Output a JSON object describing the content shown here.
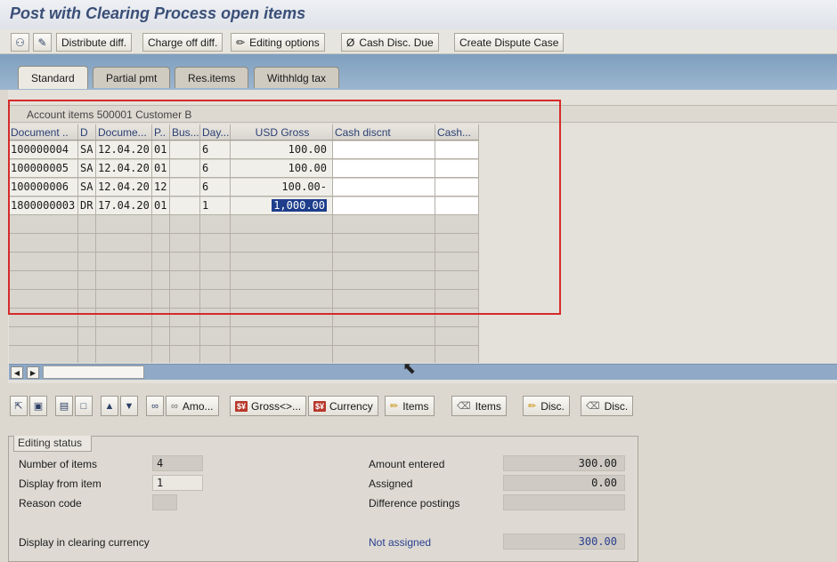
{
  "window": {
    "title": "Post with Clearing Process open items"
  },
  "toolbar": {
    "buttons": [
      {
        "label": "Distribute diff."
      },
      {
        "label": "Charge off diff."
      },
      {
        "label": "Editing options"
      },
      {
        "label": "Cash Disc. Due"
      },
      {
        "label": "Create Dispute Case"
      }
    ]
  },
  "tabs": [
    {
      "label": "Standard",
      "active": true
    },
    {
      "label": "Partial pmt",
      "active": false
    },
    {
      "label": "Res.items",
      "active": false
    },
    {
      "label": "Withhldg tax",
      "active": false
    }
  ],
  "grid": {
    "title": "Account items 500001 Customer B",
    "columns": [
      "Document ..",
      "D",
      "Docume...",
      "P..",
      "Bus...",
      "Day...",
      "USD Gross",
      "Cash discnt",
      "Cash..."
    ],
    "rows": [
      {
        "doc": "100000004",
        "d": "SA",
        "date": "12.04.20",
        "p": "01",
        "bus": "",
        "day": "6",
        "gross": "100.00",
        "cash_discnt": "",
        "cash": ""
      },
      {
        "doc": "100000005",
        "d": "SA",
        "date": "12.04.20",
        "p": "01",
        "bus": "",
        "day": "6",
        "gross": "100.00",
        "cash_discnt": "",
        "cash": ""
      },
      {
        "doc": "100000006",
        "d": "SA",
        "date": "12.04.20",
        "p": "12",
        "bus": "",
        "day": "6",
        "gross": "100.00-",
        "cash_discnt": "",
        "cash": ""
      },
      {
        "doc": "1800000003",
        "d": "DR",
        "date": "17.04.20",
        "p": "01",
        "bus": "",
        "day": "1",
        "gross": "1,000.00",
        "cash_discnt": "",
        "cash": ""
      }
    ]
  },
  "grid_toolbar": {
    "buttons": [
      {
        "label": "Amo..."
      },
      {
        "label": "Gross<>..."
      },
      {
        "label": "Currency"
      },
      {
        "label": "Items"
      },
      {
        "label": "Items"
      },
      {
        "label": "Disc."
      },
      {
        "label": "Disc."
      }
    ]
  },
  "editing_status": {
    "caption": "Editing status",
    "number_of_items_label": "Number of items",
    "number_of_items": "4",
    "display_from_item_label": "Display from item",
    "display_from_item": "1",
    "reason_code_label": "Reason code",
    "reason_code": "",
    "display_clearing_label": "Display in clearing currency",
    "amount_entered_label": "Amount entered",
    "amount_entered": "300.00",
    "assigned_label": "Assigned",
    "assigned": "0.00",
    "difference_postings_label": "Difference postings",
    "difference_postings": "",
    "not_assigned_label": "Not assigned",
    "not_assigned": "300.00"
  }
}
